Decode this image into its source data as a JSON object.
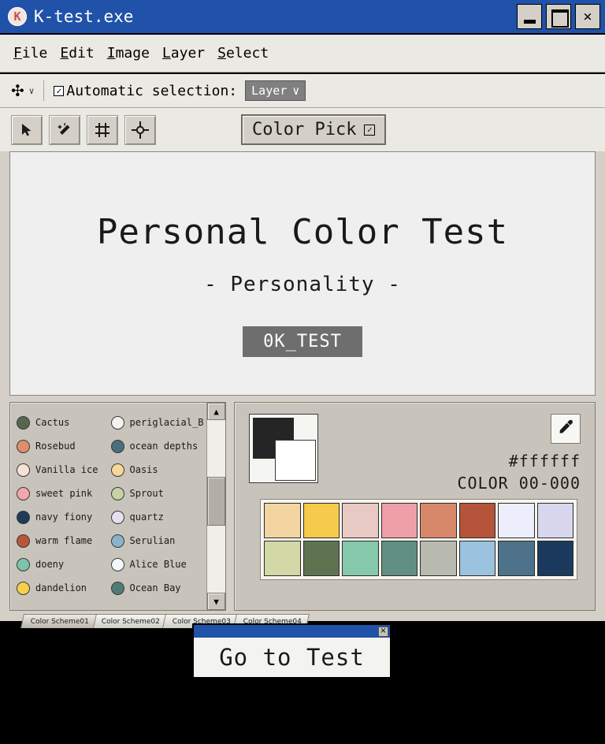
{
  "window": {
    "title": "K-test.exe",
    "icon": "K",
    "buttons": {
      "minimize": "minimize-icon",
      "maximize": "maximize-icon",
      "close": "×"
    }
  },
  "menubar": {
    "items": [
      {
        "label": "File",
        "accel": "F"
      },
      {
        "label": "Edit",
        "accel": "E"
      },
      {
        "label": "Image",
        "accel": "I"
      },
      {
        "label": "Layer",
        "accel": "L"
      },
      {
        "label": "Select",
        "accel": "S"
      }
    ]
  },
  "optionsbar": {
    "move_tool_icon": "move-tool-icon",
    "caret": "∨",
    "checkbox_glyph": "☑",
    "auto_selection_label": "Automatic selection:",
    "layer_select_value": "Layer",
    "layer_select_caret": "∨"
  },
  "toolstrip": {
    "tools": [
      {
        "name": "pointer-tool",
        "icon": "pointer-icon"
      },
      {
        "name": "magic-wand-tool",
        "icon": "magic-wand-icon"
      },
      {
        "name": "crop-tool",
        "icon": "crop-icon"
      },
      {
        "name": "target-tool",
        "icon": "target-icon"
      }
    ],
    "color_pick_label": "Color Pick",
    "color_pick_box_glyph": "☑"
  },
  "canvas": {
    "title": "Personal Color Test",
    "subtitle": "- Personality -",
    "ok_button": "0K_TEST"
  },
  "color_list": {
    "items": [
      {
        "name": "Cactus",
        "hex": "#54684f"
      },
      {
        "name": "periglacial_B",
        "hex": "#f2f2ee"
      },
      {
        "name": "Rosebud",
        "hex": "#dd8e6d"
      },
      {
        "name": "ocean depths",
        "hex": "#4a6f7c"
      },
      {
        "name": "Vanilla ice",
        "hex": "#f6e2d4"
      },
      {
        "name": "Oasis",
        "hex": "#f6d79b"
      },
      {
        "name": "sweet pink",
        "hex": "#f4a6ad"
      },
      {
        "name": "Sprout",
        "hex": "#c7d3a5"
      },
      {
        "name": "navy fiony",
        "hex": "#1e3a5c"
      },
      {
        "name": "quartz",
        "hex": "#e4e0ef"
      },
      {
        "name": "warm flame",
        "hex": "#b85738"
      },
      {
        "name": "Serulian",
        "hex": "#8cb3c9"
      },
      {
        "name": "doeny",
        "hex": "#7ec3ac"
      },
      {
        "name": "Alice Blue",
        "hex": "#f3f7fc"
      },
      {
        "name": "dandelion",
        "hex": "#f7d04a"
      },
      {
        "name": "Ocean Bay",
        "hex": "#4f7d74"
      }
    ],
    "scrollbar": {
      "up_arrow": "▲",
      "down_arrow": "▼"
    }
  },
  "swatch_panel": {
    "foreground_color": "#252525",
    "background_color": "#ffffff",
    "eyedropper_icon": "eyedropper-icon",
    "hex_value": "#ffffff",
    "color_code": "COLOR 00-000",
    "swatches": [
      "#f2d5a0",
      "#f6cb4b",
      "#e8cac4",
      "#ef9fa8",
      "#d8886a",
      "#b5543a",
      "#eceefb",
      "#d8d7ee",
      "#d2d8a6",
      "#5f7351",
      "#86c8ab",
      "#619082",
      "#b9bbb0",
      "#9bc2df",
      "#4d7289",
      "#1b3a5e"
    ]
  },
  "tabs": [
    {
      "label": "Color Scheme01",
      "active": true
    },
    {
      "label": "Color Scheme02",
      "active": false
    },
    {
      "label": "Color Scheme03",
      "active": false
    },
    {
      "label": "Color Scheme04",
      "active": false
    }
  ],
  "dialog": {
    "text": "Go to Test",
    "close_glyph": "×"
  }
}
